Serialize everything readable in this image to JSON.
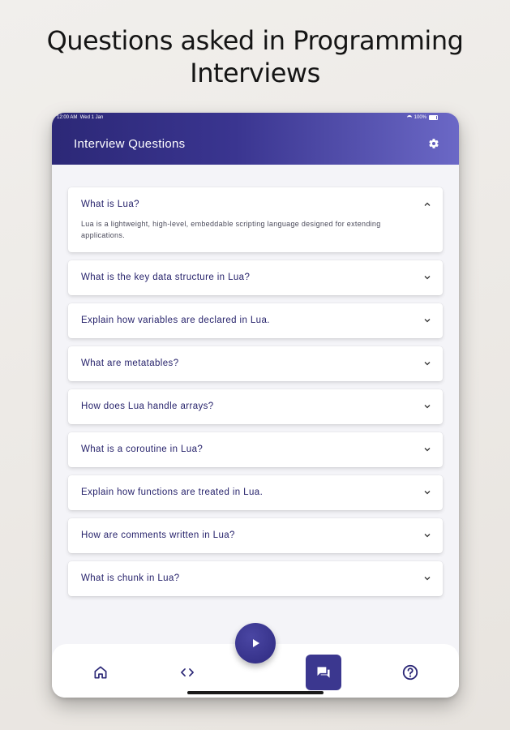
{
  "headline": {
    "line1": "Questions asked in Programming",
    "line2": "Interviews"
  },
  "status_bar": {
    "time": "12:00 AM",
    "date": "Wed 1 Jan",
    "battery": "100%"
  },
  "app_bar": {
    "title": "Interview Questions",
    "settings_icon": "gear-icon"
  },
  "questions": [
    {
      "question": "What is Lua?",
      "answer": "Lua is a lightweight, high-level, embeddable scripting language designed for extending applications.",
      "expanded": true
    },
    {
      "question": "What is the key data structure in Lua?",
      "expanded": false
    },
    {
      "question": "Explain how variables are declared in Lua.",
      "expanded": false
    },
    {
      "question": "What are metatables?",
      "expanded": false
    },
    {
      "question": "How does Lua handle arrays?",
      "expanded": false
    },
    {
      "question": "What is a coroutine in Lua?",
      "expanded": false
    },
    {
      "question": "Explain how functions are treated in Lua.",
      "expanded": false
    },
    {
      "question": "How are comments written in Lua?",
      "expanded": false
    },
    {
      "question": "What is chunk in Lua?",
      "expanded": false
    }
  ],
  "bottom_nav": {
    "items": [
      {
        "icon": "home-icon",
        "active": false
      },
      {
        "icon": "code-icon",
        "active": false
      },
      {
        "icon": "chat-icon",
        "active": true
      },
      {
        "icon": "help-icon",
        "active": false
      }
    ],
    "fab_icon": "play-icon"
  },
  "colors": {
    "primary": "#2c2877",
    "accent_light": "#6b68c6",
    "question_text": "#26226b",
    "background": "#f4f4f8"
  }
}
